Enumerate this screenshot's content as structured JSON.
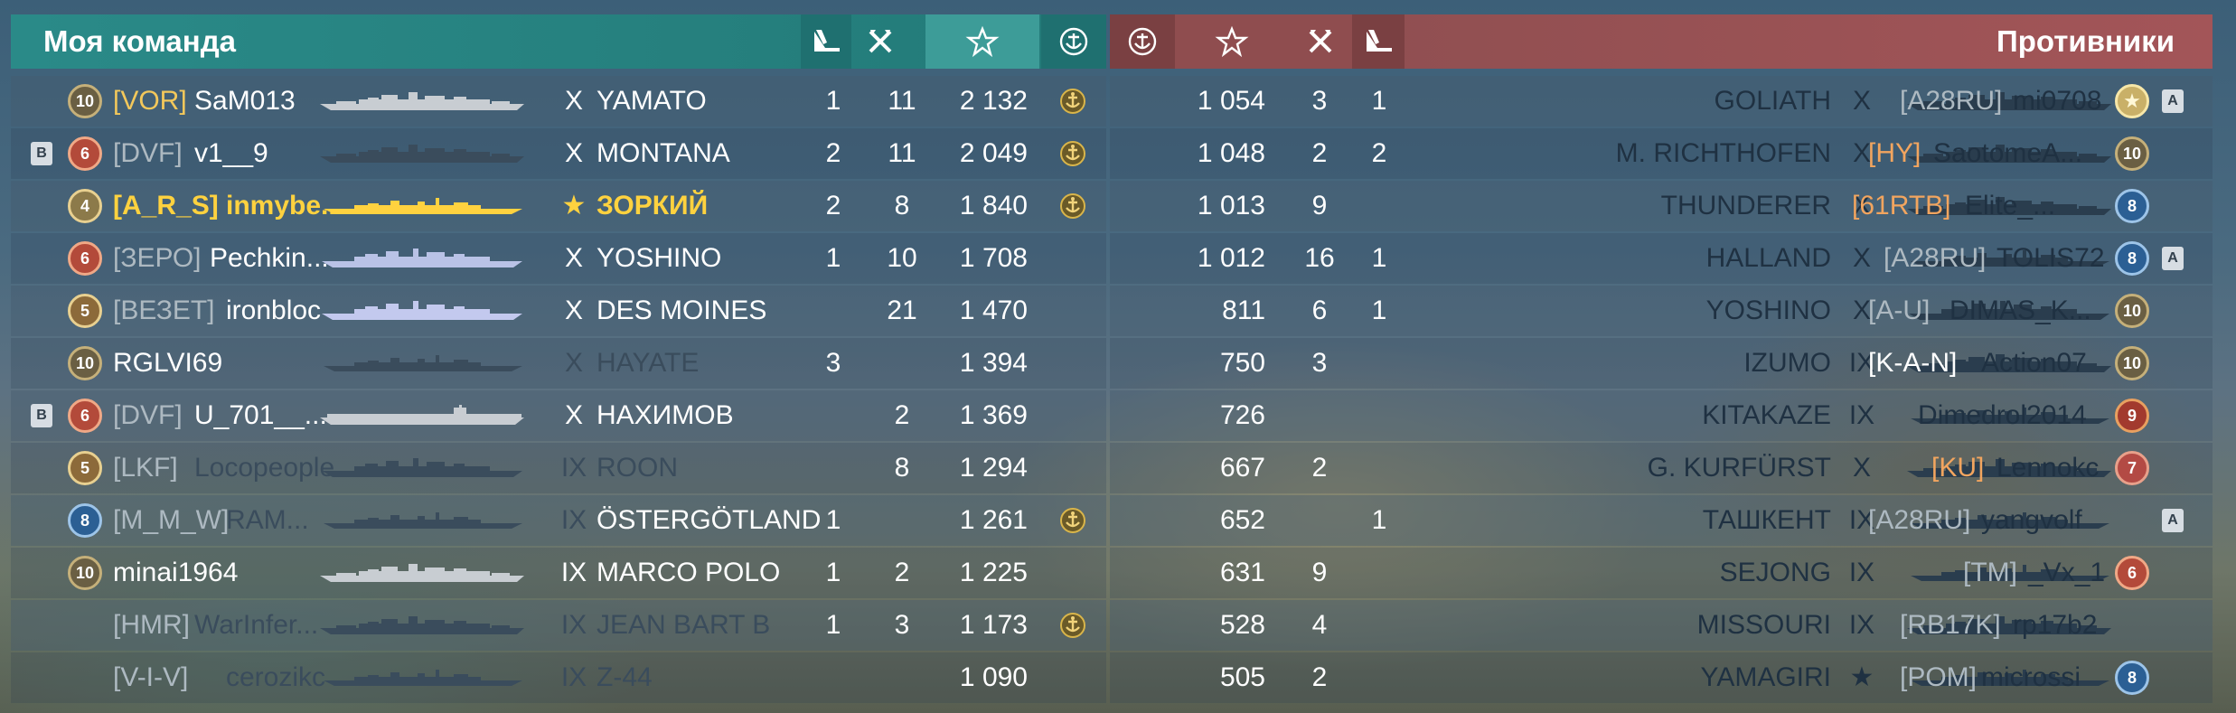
{
  "header": {
    "my_team_title": "Моя команда",
    "enemies_title": "Противники",
    "left_icons": [
      "planes-destroyed-icon",
      "frags-icon",
      "experience-star-icon",
      "anchor-emblem-icon"
    ],
    "right_icons": [
      "anchor-emblem-icon",
      "experience-star-icon",
      "frags-icon",
      "planes-destroyed-icon"
    ]
  },
  "colors": {
    "ally_header": "#2a8a88",
    "enemy_header": "#a35558",
    "player_highlight": "#ffd23f",
    "clan_gold": "#f3c85b",
    "clan_orange": "#f2a55f"
  },
  "my_team": [
    {
      "badge": "",
      "level": "10",
      "clan": "[VOR]",
      "name": "SaM013",
      "tier": "X",
      "ship": "YAMATO",
      "planes": "1",
      "frags": "11",
      "score": "2 132",
      "emblem": "anchor-emblem-icon",
      "clan_style": "gold",
      "silhouette": "battleship-icon",
      "sil_color": "#c8cdd2"
    },
    {
      "badge": "В",
      "level": "6",
      "clan": "[DVF]",
      "name": "v1__9",
      "tier": "X",
      "ship": "MONTANA",
      "planes": "2",
      "frags": "11",
      "score": "2 049",
      "emblem": "anchor-emblem-icon",
      "clan_style": "dim",
      "silhouette": "battleship-icon",
      "sil_color": "#3a4c5c"
    },
    {
      "badge": "",
      "level": "4",
      "clan": "[A_R_S]",
      "name": "inmybe...",
      "tier": "★",
      "ship": "ЗОРКИЙ",
      "planes": "2",
      "frags": "8",
      "score": "1 840",
      "emblem": "anchor-emblem-icon",
      "clan_style": "self",
      "silhouette": "destroyer-icon",
      "sil_color": "#ffd23f"
    },
    {
      "badge": "",
      "level": "6",
      "clan": "[ЗЕРО]",
      "name": "Pechkin...",
      "tier": "X",
      "ship": "YOSHINO",
      "planes": "1",
      "frags": "10",
      "score": "1 708",
      "emblem": "",
      "clan_style": "dim",
      "silhouette": "cruiser-icon",
      "sil_color": "#b9c2e6"
    },
    {
      "badge": "",
      "level": "5",
      "clan": "[ВЕЗЕТ]",
      "name": "ironbloc",
      "tier": "X",
      "ship": "DES MOINES",
      "planes": "",
      "frags": "21",
      "score": "1 470",
      "emblem": "",
      "clan_style": "dim",
      "silhouette": "cruiser-icon",
      "sil_color": "#c3c9ee"
    },
    {
      "badge": "",
      "level": "10",
      "clan": "",
      "name": "RGLVI69",
      "tier": "X",
      "ship": "HAYATE",
      "planes": "3",
      "frags": "",
      "score": "1 394",
      "emblem": "",
      "clan_style": "dim",
      "silhouette": "destroyer-icon",
      "sil_color": "#3a4c5c"
    },
    {
      "badge": "В",
      "level": "6",
      "clan": "[DVF]",
      "name": "U_701__...",
      "tier": "X",
      "ship": "НАХИМОВ",
      "planes": "",
      "frags": "2",
      "score": "1 369",
      "emblem": "",
      "clan_style": "dim",
      "silhouette": "carrier-icon",
      "sil_color": "#c8cdd2"
    },
    {
      "badge": "",
      "level": "5",
      "clan": "[LKF]",
      "name": "Locopeople",
      "tier": "IX",
      "ship": "ROON",
      "planes": "",
      "frags": "8",
      "score": "1 294",
      "emblem": "",
      "clan_style": "dim",
      "silhouette": "cruiser-icon",
      "sil_color": "#3a4c5c"
    },
    {
      "badge": "",
      "level": "8",
      "clan": "[M_M_W]",
      "name": "RAM...",
      "tier": "IX",
      "ship": "ÖSTERGÖTLAND",
      "planes": "1",
      "frags": "",
      "score": "1 261",
      "emblem": "anchor-emblem-icon",
      "clan_style": "dim",
      "silhouette": "destroyer-icon",
      "sil_color": "#3a4c5c"
    },
    {
      "badge": "",
      "level": "10",
      "clan": "",
      "name": "minai1964",
      "tier": "IX",
      "ship": "MARCO POLO",
      "planes": "1",
      "frags": "2",
      "score": "1 225",
      "emblem": "",
      "clan_style": "dim",
      "silhouette": "battleship-icon",
      "sil_color": "#c8cdd2"
    },
    {
      "badge": "",
      "level": "",
      "clan": "[HMR]",
      "name": "WarInfer...",
      "tier": "IX",
      "ship": "JEAN BART B",
      "planes": "1",
      "frags": "3",
      "score": "1 173",
      "emblem": "anchor-emblem-icon",
      "clan_style": "dim",
      "silhouette": "battleship-icon",
      "sil_color": "#3a4c5c"
    },
    {
      "badge": "",
      "level": "",
      "clan": "[V-I-V]",
      "name": "cerozikc",
      "tier": "IX",
      "ship": "Z-44",
      "planes": "",
      "frags": "",
      "score": "1 090",
      "emblem": "",
      "clan_style": "dim",
      "silhouette": "destroyer-icon",
      "sil_color": "#3a4c5c"
    }
  ],
  "enemies": [
    {
      "score": "1 054",
      "frags": "3",
      "planes": "1",
      "ship": "GOLIATH",
      "tier": "X",
      "clan": "[A28RU]",
      "name": "mi0708",
      "level": "★",
      "badge": "A",
      "emblem": "",
      "clan_style": "dim",
      "silhouette": "battleship-icon"
    },
    {
      "score": "1 048",
      "frags": "2",
      "planes": "2",
      "ship": "M. RICHTHOFEN",
      "tier": "X",
      "clan": "[HY]",
      "name": "SaotomeA...",
      "level": "10",
      "badge": "",
      "emblem": "",
      "clan_style": "orange",
      "silhouette": "battleship-icon"
    },
    {
      "score": "1 013",
      "frags": "9",
      "planes": "",
      "ship": "THUNDERER",
      "tier": "X",
      "clan": "[61RTB]",
      "name": "Elite_...",
      "level": "8",
      "badge": "",
      "emblem": "",
      "clan_style": "orange",
      "silhouette": "battleship-icon"
    },
    {
      "score": "1 012",
      "frags": "16",
      "planes": "1",
      "ship": "HALLAND",
      "tier": "X",
      "clan": "[A28RU]",
      "name": "TOLIS72",
      "level": "8",
      "badge": "A",
      "emblem": "",
      "clan_style": "dim",
      "silhouette": "destroyer-icon"
    },
    {
      "score": "811",
      "frags": "6",
      "planes": "1",
      "ship": "YOSHINO",
      "tier": "X",
      "clan": "[A-U]",
      "name": "DIMAS_K...",
      "level": "10",
      "badge": "",
      "emblem": "",
      "clan_style": "dim",
      "silhouette": "cruiser-icon"
    },
    {
      "score": "750",
      "frags": "3",
      "planes": "",
      "ship": "IZUMO",
      "tier": "IX",
      "clan": "[K-A-N]",
      "name": "Action07",
      "level": "10",
      "badge": "",
      "emblem": "",
      "clan_style": "white",
      "silhouette": "battleship-icon"
    },
    {
      "score": "726",
      "frags": "",
      "planes": "",
      "ship": "KITAKAZE",
      "tier": "IX",
      "clan": "",
      "name": "Dimedrol2014",
      "level": "9",
      "badge": "",
      "emblem": "",
      "clan_style": "dim",
      "silhouette": "destroyer-icon"
    },
    {
      "score": "667",
      "frags": "2",
      "planes": "",
      "ship": "G. KURFÜRST",
      "tier": "X",
      "clan": "[KU]",
      "name": "Lennokc",
      "level": "7",
      "badge": "",
      "emblem": "",
      "clan_style": "orange",
      "silhouette": "battleship-icon"
    },
    {
      "score": "652",
      "frags": "",
      "planes": "1",
      "ship": "ТАШКЕНТ",
      "tier": "IX",
      "clan": "[A28RU]",
      "name": "yangvolf",
      "level": "",
      "badge": "A",
      "emblem": "",
      "clan_style": "dim",
      "silhouette": "destroyer-icon"
    },
    {
      "score": "631",
      "frags": "9",
      "planes": "",
      "ship": "SEJONG",
      "tier": "IX",
      "clan": "[TM]",
      "name": "_Vx_1",
      "level": "6",
      "badge": "",
      "emblem": "",
      "clan_style": "dim",
      "silhouette": "destroyer-icon"
    },
    {
      "score": "528",
      "frags": "4",
      "planes": "",
      "ship": "MISSOURI",
      "tier": "IX",
      "clan": "[RB17K]",
      "name": "rp17b2",
      "level": "",
      "badge": "",
      "emblem": "",
      "clan_style": "dim",
      "silhouette": "battleship-icon"
    },
    {
      "score": "505",
      "frags": "2",
      "planes": "",
      "ship": "YAMAGIRI",
      "tier": "★",
      "clan": "[POM]",
      "name": "microssi",
      "level": "8",
      "badge": "",
      "emblem": "",
      "clan_style": "dim",
      "silhouette": "destroyer-icon"
    }
  ]
}
